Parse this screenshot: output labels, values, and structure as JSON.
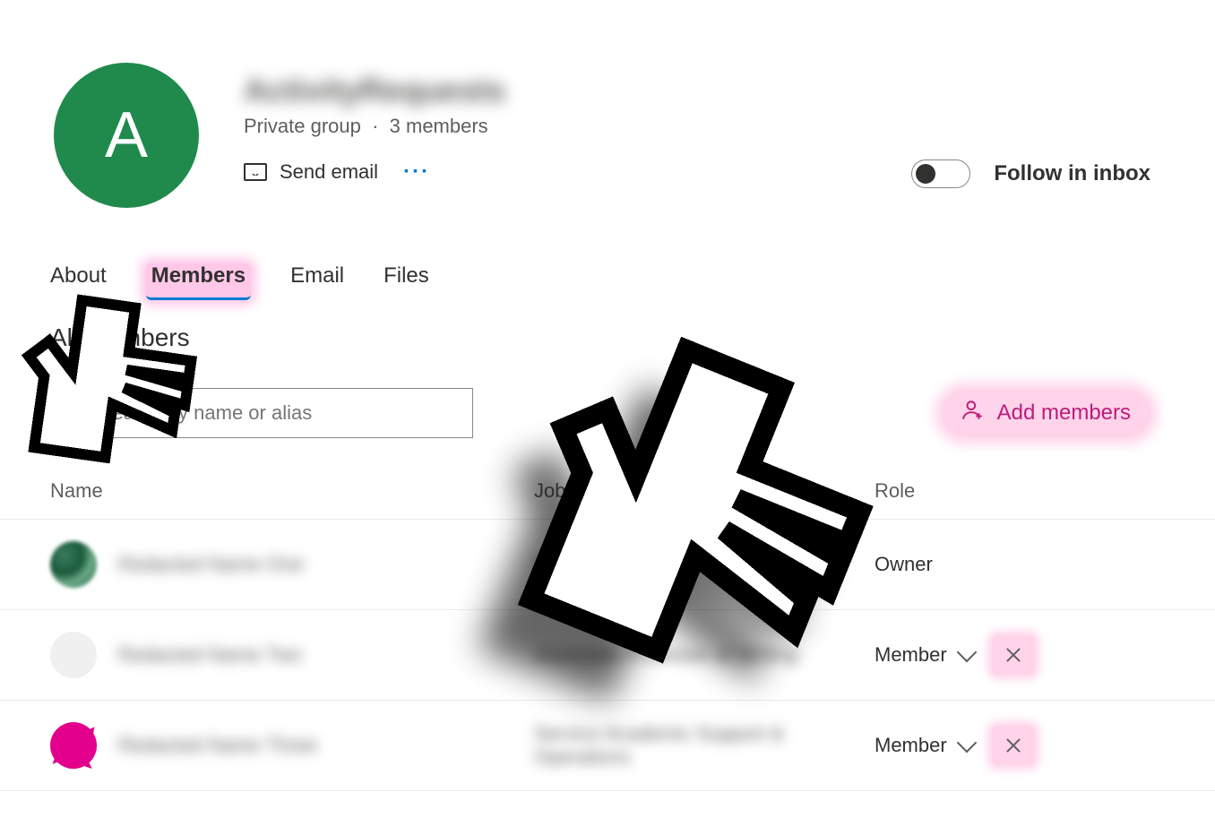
{
  "group": {
    "avatar_initial": "A",
    "title": "ActivityRequests",
    "privacy": "Private group",
    "member_count_label": "3 members",
    "send_email_label": "Send email",
    "follow_label": "Follow in inbox"
  },
  "tabs": {
    "about": "About",
    "members": "Members",
    "email": "Email",
    "files": "Files"
  },
  "members_section": {
    "title": "All members",
    "search_placeholder": "Search by name or alias",
    "add_label": "Add members",
    "columns": {
      "name": "Name",
      "job_title": "Job title",
      "role": "Role"
    }
  },
  "roles": {
    "owner": "Owner",
    "member": "Member"
  },
  "members": [
    {
      "name": "Redacted Name One",
      "job_title": "Redacted Title",
      "role_key": "owner",
      "removable": false
    },
    {
      "name": "Redacted Name Two",
      "job_title": "Associate Professor of Writing",
      "role_key": "member",
      "removable": true
    },
    {
      "name": "Redacted Name Three",
      "job_title": "Service Academic Support & Operations",
      "role_key": "member",
      "removable": true
    }
  ]
}
